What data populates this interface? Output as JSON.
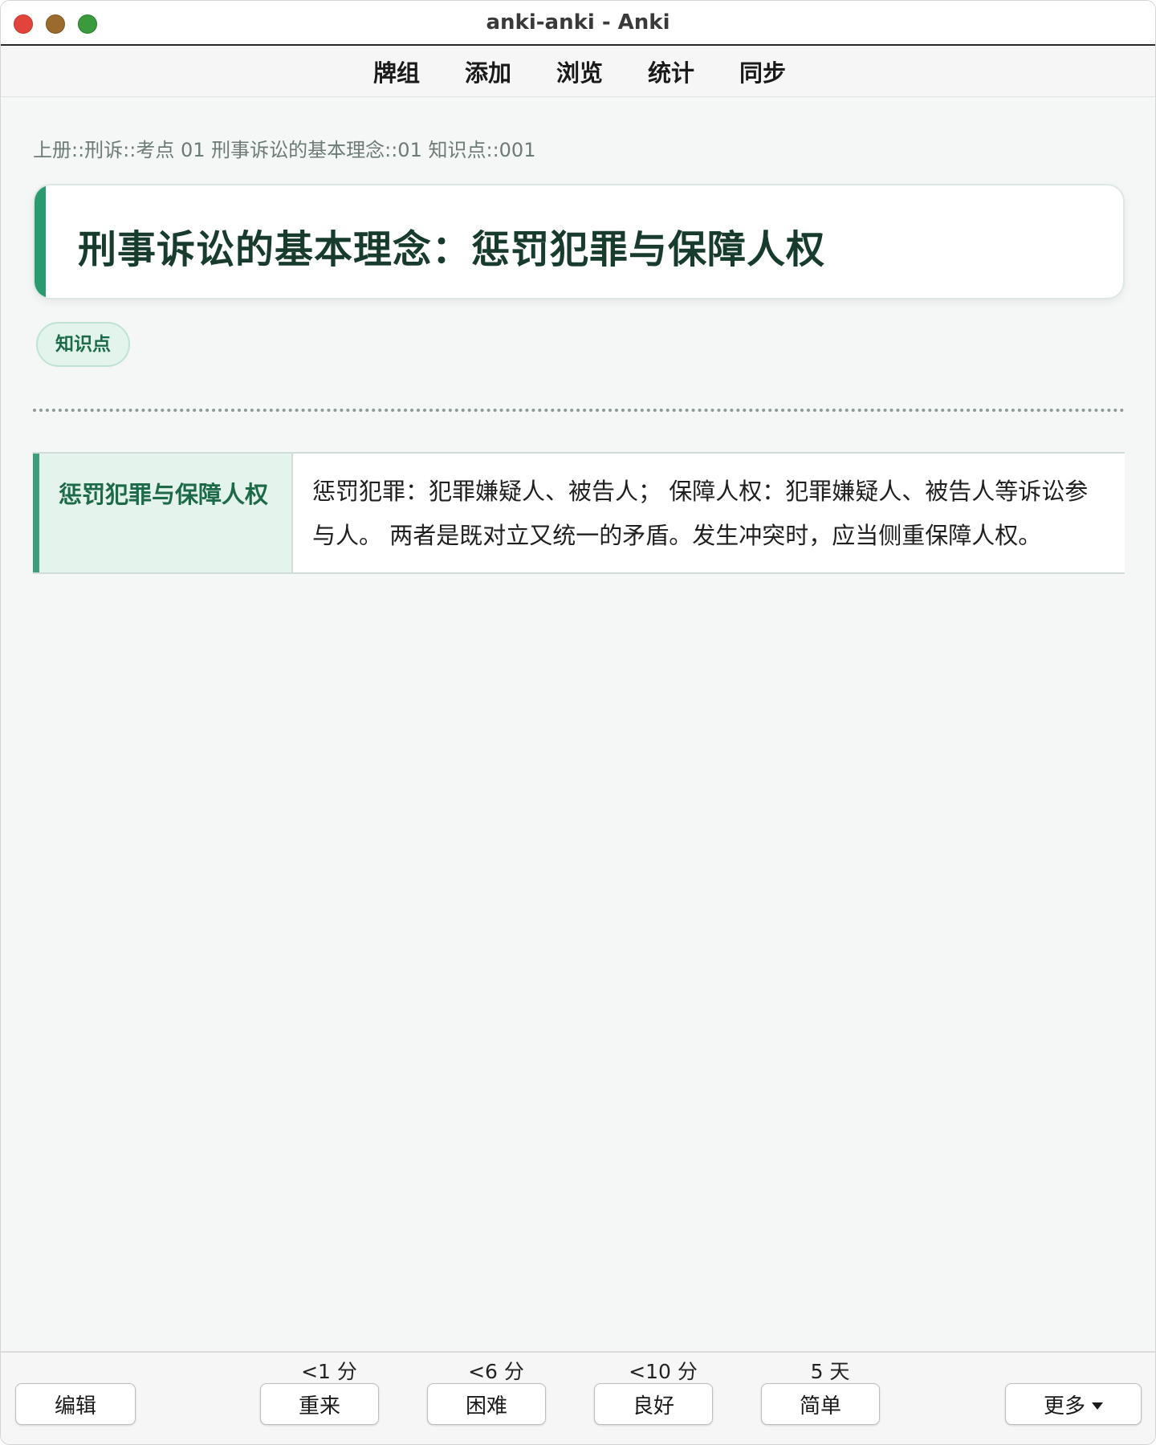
{
  "window": {
    "title": "anki-anki - Anki"
  },
  "nav": {
    "items": [
      {
        "label": "牌组"
      },
      {
        "label": "添加"
      },
      {
        "label": "浏览"
      },
      {
        "label": "统计"
      },
      {
        "label": "同步"
      }
    ]
  },
  "card": {
    "breadcrumb": "上册::刑诉::考点 01 刑事诉讼的基本理念::01 知识点::001",
    "title": "刑事诉讼的基本理念：惩罚犯罪与保障人权",
    "tag": "知识点",
    "table": {
      "heading": "惩罚犯罪与保障人权",
      "body": "惩罚犯罪：犯罪嫌疑人、被告人； 保障人权：犯罪嫌疑人、被告人等诉讼参与人。 两者是既对立又统一的矛盾。发生冲突时，应当侧重保障人权。"
    }
  },
  "bottom": {
    "edit_label": "编辑",
    "more_label": "更多",
    "answers": [
      {
        "interval": "<1 分",
        "label": "重来"
      },
      {
        "interval": "<6 分",
        "label": "困难"
      },
      {
        "interval": "<10 分",
        "label": "良好"
      },
      {
        "interval": "5 天",
        "label": "简单"
      }
    ]
  }
}
